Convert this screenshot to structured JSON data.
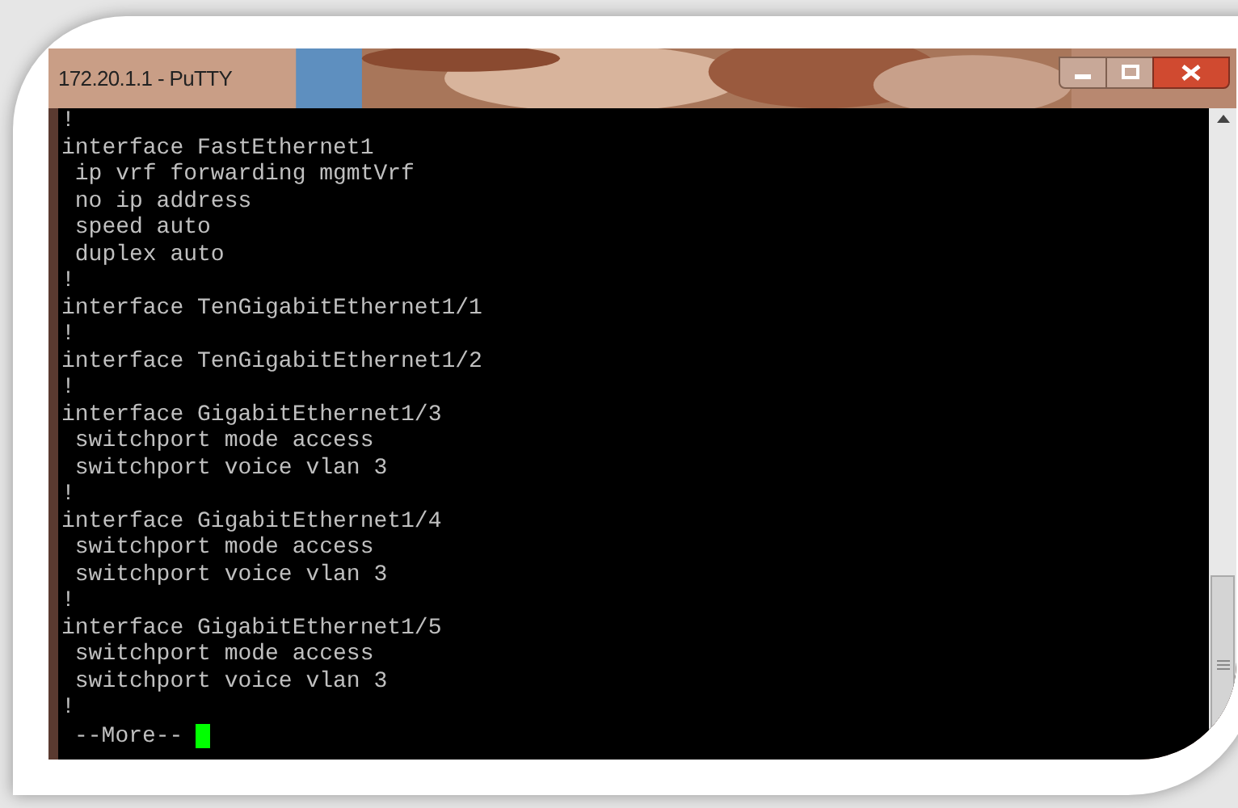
{
  "window": {
    "title": "172.20.1.1 - PuTTY"
  },
  "terminal": {
    "lines": [
      "!",
      "interface FastEthernet1",
      " ip vrf forwarding mgmtVrf",
      " no ip address",
      " speed auto",
      " duplex auto",
      "!",
      "interface TenGigabitEthernet1/1",
      "!",
      "interface TenGigabitEthernet1/2",
      "!",
      "interface GigabitEthernet1/3",
      " switchport mode access",
      " switchport voice vlan 3",
      "!",
      "interface GigabitEthernet1/4",
      " switchport mode access",
      " switchport voice vlan 3",
      "!",
      "interface GigabitEthernet1/5",
      " switchport mode access",
      " switchport voice vlan 3",
      "!"
    ],
    "prompt": "--More--"
  }
}
